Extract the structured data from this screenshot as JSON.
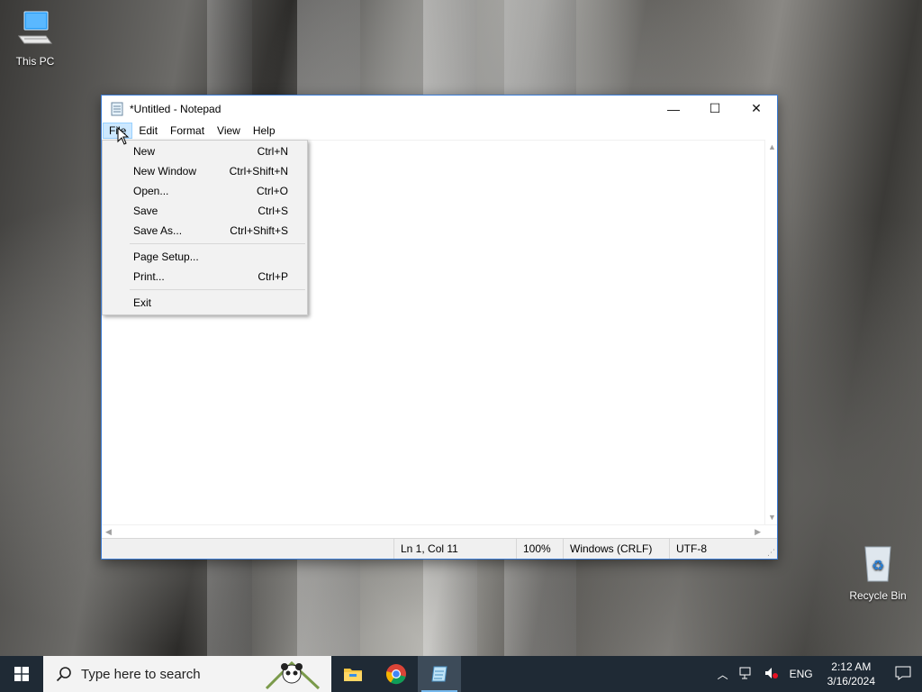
{
  "desktop": {
    "icons": [
      {
        "label": "This PC"
      },
      {
        "label": "Recycle Bin"
      }
    ]
  },
  "window": {
    "title": "*Untitled - Notepad",
    "controls": {
      "minimize": "—",
      "maximize": "☐",
      "close": "✕"
    }
  },
  "menubar": {
    "items": [
      {
        "label": "File",
        "active": true
      },
      {
        "label": "Edit"
      },
      {
        "label": "Format"
      },
      {
        "label": "View"
      },
      {
        "label": "Help"
      }
    ]
  },
  "file_menu": {
    "items": [
      {
        "label": "New",
        "shortcut": "Ctrl+N"
      },
      {
        "label": "New Window",
        "shortcut": "Ctrl+Shift+N"
      },
      {
        "label": "Open...",
        "shortcut": "Ctrl+O"
      },
      {
        "label": "Save",
        "shortcut": "Ctrl+S"
      },
      {
        "label": "Save As...",
        "shortcut": "Ctrl+Shift+S"
      },
      {
        "label": "Page Setup...",
        "shortcut": ""
      },
      {
        "label": "Print...",
        "shortcut": "Ctrl+P"
      },
      {
        "label": "Exit",
        "shortcut": ""
      }
    ]
  },
  "statusbar": {
    "position": "Ln 1, Col 11",
    "zoom": "100%",
    "line_ending": "Windows (CRLF)",
    "encoding": "UTF-8"
  },
  "taskbar": {
    "search_placeholder": "Type here to search",
    "apps": [
      "file-explorer",
      "chrome",
      "notepad"
    ],
    "language": "ENG",
    "time": "2:12 AM",
    "date": "3/16/2024"
  },
  "colors": {
    "taskbar_bg": "#1f2a35",
    "menu_highlight": "#cce8ff",
    "window_border": "#3a7bd5"
  }
}
